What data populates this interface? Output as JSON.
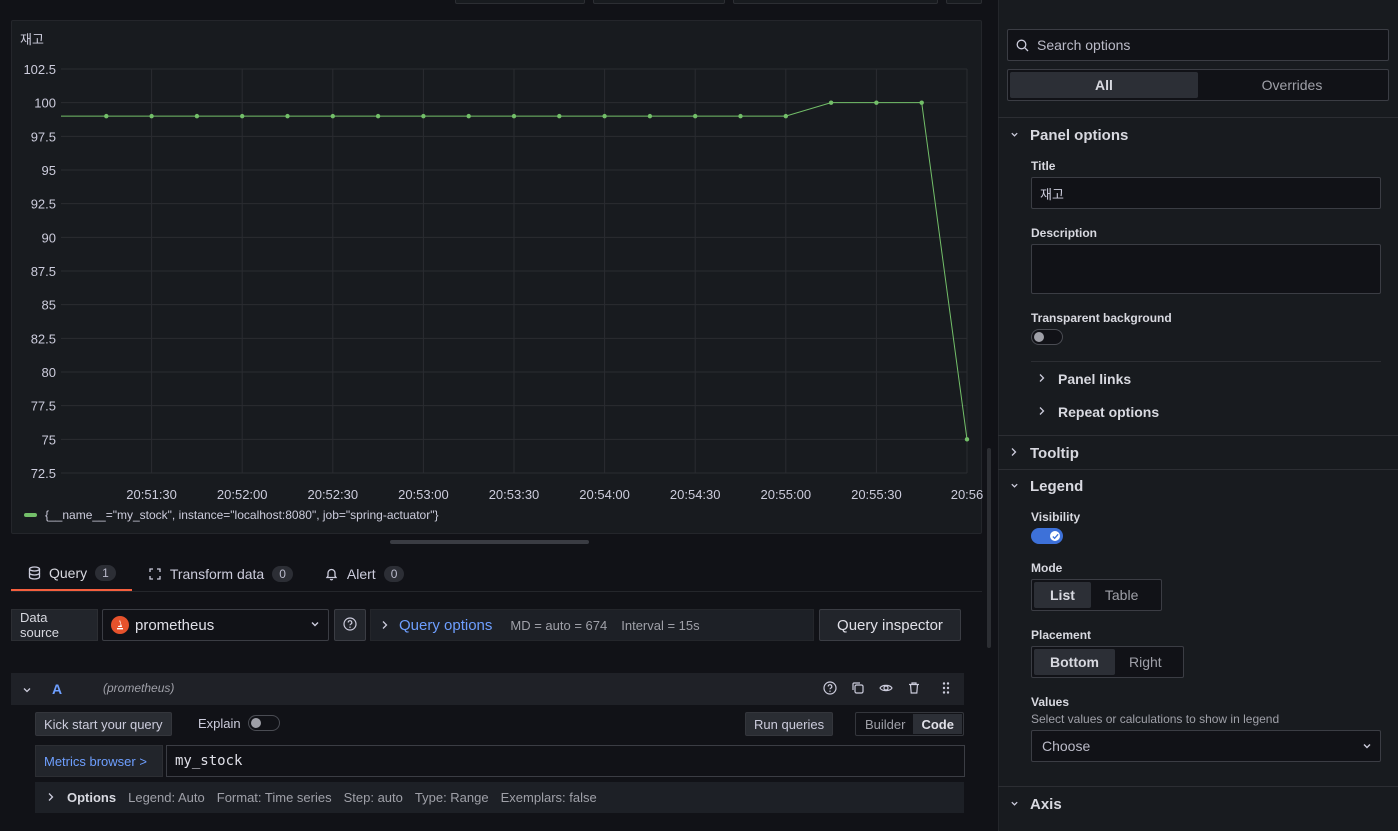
{
  "panel": {
    "title": "재고",
    "legend": "{__name__=\"my_stock\", instance=\"localhost:8080\", job=\"spring-actuator\"}"
  },
  "chart_data": {
    "type": "line",
    "y_ticks": [
      "102.5",
      "100",
      "97.5",
      "95",
      "92.5",
      "90",
      "87.5",
      "85",
      "82.5",
      "80",
      "77.5",
      "75",
      "72.5"
    ],
    "ylim": [
      72.5,
      102.5
    ],
    "x_ticks": [
      "20:51:30",
      "20:52:00",
      "20:52:30",
      "20:53:00",
      "20:53:30",
      "20:54:00",
      "20:54:30",
      "20:55:00",
      "20:55:30",
      "20:56"
    ],
    "grid": true,
    "series": [
      {
        "name": "{__name__=\"my_stock\", instance=\"localhost:8080\", job=\"spring-actuator\"}",
        "color": "#73bf69",
        "x": [
          "20:51:15",
          "20:51:30",
          "20:51:45",
          "20:52:00",
          "20:52:15",
          "20:52:30",
          "20:52:45",
          "20:53:00",
          "20:53:15",
          "20:53:30",
          "20:53:45",
          "20:54:00",
          "20:54:15",
          "20:54:30",
          "20:54:45",
          "20:55:00",
          "20:55:15",
          "20:55:30",
          "20:55:45",
          "20:56:00"
        ],
        "values": [
          99,
          99,
          99,
          99,
          99,
          99,
          99,
          99,
          99,
          99,
          99,
          99,
          99,
          99,
          99,
          99,
          100,
          100,
          100,
          75
        ]
      }
    ]
  },
  "tabs": [
    {
      "label": "Query",
      "count": "1",
      "icon": "database-icon"
    },
    {
      "label": "Transform data",
      "count": "0",
      "icon": "transform-icon"
    },
    {
      "label": "Alert",
      "count": "0",
      "icon": "bell-icon"
    }
  ],
  "datasource": {
    "label": "Data source",
    "value": "prometheus",
    "query_options_label": "Query options",
    "md": "MD = auto = 674",
    "interval": "Interval = 15s",
    "inspector": "Query inspector"
  },
  "query_a": {
    "ref": "A",
    "ds": "(prometheus)",
    "kick_start": "Kick start your query",
    "explain": "Explain",
    "run": "Run queries",
    "builder": "Builder",
    "code": "Code",
    "metrics_browser": "Metrics browser >",
    "expr": "my_stock",
    "options_label": "Options",
    "opt_legend": "Legend: Auto",
    "opt_format": "Format: Time series",
    "opt_step": "Step: auto",
    "opt_type": "Type: Range",
    "opt_exemplars": "Exemplars: false"
  },
  "right": {
    "search_placeholder": "Search options",
    "all": "All",
    "overrides": "Overrides",
    "panel_options": "Panel options",
    "title_label": "Title",
    "title_value": "재고",
    "description_label": "Description",
    "transparent_label": "Transparent background",
    "panel_links": "Panel links",
    "repeat_options": "Repeat options",
    "tooltip": "Tooltip",
    "legend": "Legend",
    "visibility": "Visibility",
    "mode": "Mode",
    "mode_list": "List",
    "mode_table": "Table",
    "placement": "Placement",
    "placement_bottom": "Bottom",
    "placement_right": "Right",
    "values": "Values",
    "values_desc": "Select values or calculations to show in legend",
    "values_choose": "Choose",
    "axis": "Axis"
  }
}
